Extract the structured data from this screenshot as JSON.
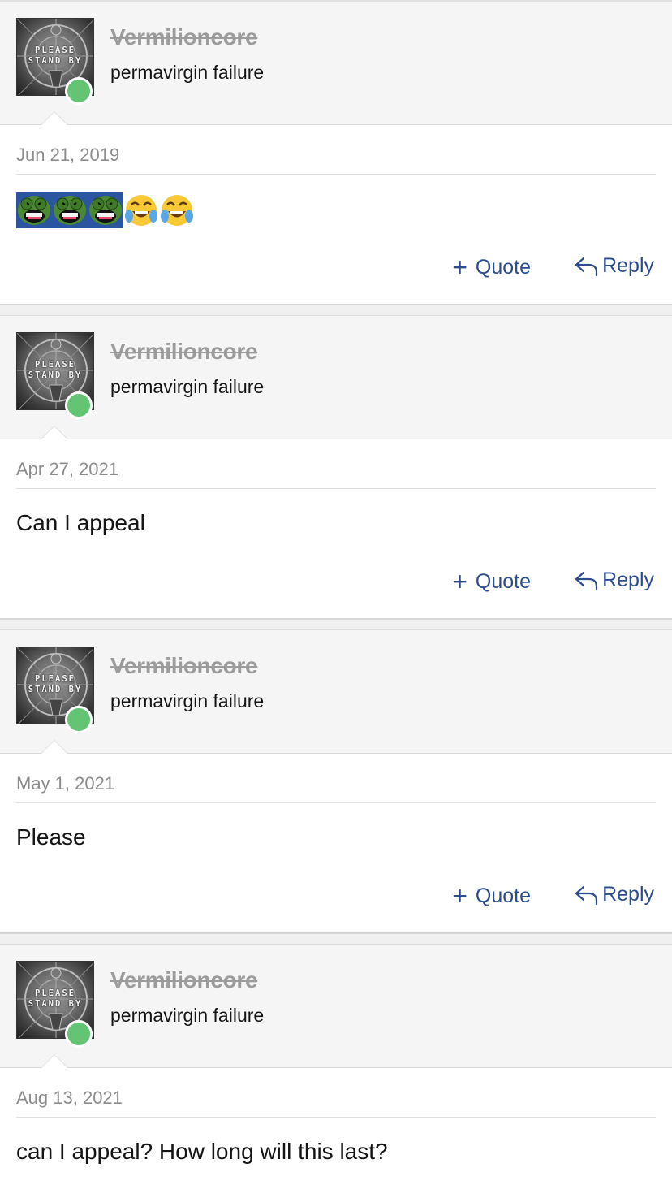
{
  "posts": [
    {
      "username": "Vermilioncore",
      "user_title": "permavirgin failure",
      "avatar_text": [
        "PLEASE",
        "STAND BY"
      ],
      "date": "Jun 21, 2019",
      "content": "",
      "emojis": [
        "pepe-laugh",
        "pepe-laugh",
        "pepe-laugh",
        "joy",
        "joy"
      ],
      "quote_label": "Quote",
      "reply_label": "Reply"
    },
    {
      "username": "Vermilioncore",
      "user_title": "permavirgin failure",
      "avatar_text": [
        "PLEASE",
        "STAND BY"
      ],
      "date": "Apr 27, 2021",
      "content": "Can I appeal",
      "quote_label": "Quote",
      "reply_label": "Reply"
    },
    {
      "username": "Vermilioncore",
      "user_title": "permavirgin failure",
      "avatar_text": [
        "PLEASE",
        "STAND BY"
      ],
      "date": "May 1, 2021",
      "content": "Please",
      "quote_label": "Quote",
      "reply_label": "Reply"
    },
    {
      "username": "Vermilioncore",
      "user_title": "permavirgin failure",
      "avatar_text": [
        "PLEASE",
        "STAND BY"
      ],
      "date": "Aug 13, 2021",
      "content": "can I appeal? How long will this last?"
    }
  ],
  "colors": {
    "link": "#2c4c8e",
    "online": "#63c574",
    "username_struck": "#9c9c9c",
    "header_bg": "#f5f5f5"
  }
}
